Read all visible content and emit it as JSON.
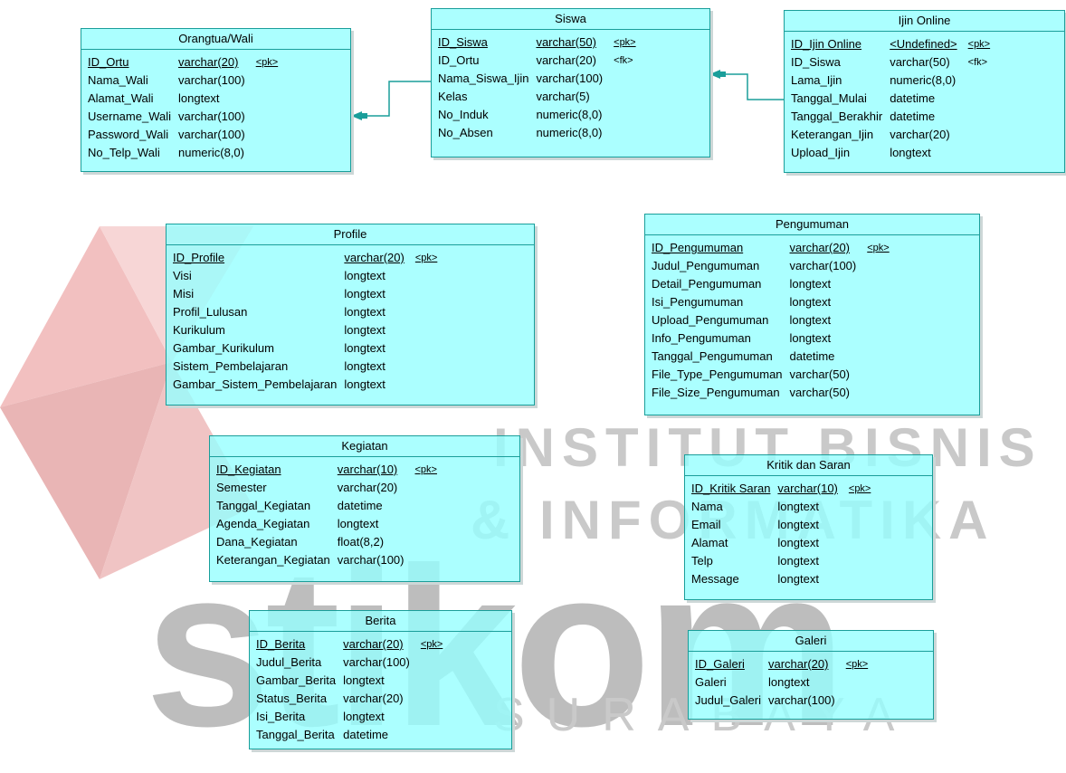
{
  "watermark": {
    "line1": "INSTITUT BISNIS",
    "line2": "& INFORMATIKA",
    "brand": "stikom",
    "line3": "SURABAYA"
  },
  "entities": {
    "orangtua": {
      "title": "Orangtua/Wali",
      "columns": [
        {
          "name": "ID_Ortu",
          "type": "varchar(20)",
          "key": "<pk>"
        },
        {
          "name": "Nama_Wali",
          "type": "varchar(100)",
          "key": ""
        },
        {
          "name": "Alamat_Wali",
          "type": "longtext",
          "key": ""
        },
        {
          "name": "Username_Wali",
          "type": "varchar(100)",
          "key": ""
        },
        {
          "name": "Password_Wali",
          "type": "varchar(100)",
          "key": ""
        },
        {
          "name": "No_Telp_Wali",
          "type": "numeric(8,0)",
          "key": ""
        }
      ]
    },
    "siswa": {
      "title": "Siswa",
      "columns": [
        {
          "name": "ID_Siswa",
          "type": "varchar(50)",
          "key": "<pk>"
        },
        {
          "name": "ID_Ortu",
          "type": "varchar(20)",
          "key": "<fk>"
        },
        {
          "name": "Nama_Siswa_Ijin",
          "type": "varchar(100)",
          "key": ""
        },
        {
          "name": "Kelas",
          "type": "varchar(5)",
          "key": ""
        },
        {
          "name": "No_Induk",
          "type": "numeric(8,0)",
          "key": ""
        },
        {
          "name": "No_Absen",
          "type": "numeric(8,0)",
          "key": ""
        }
      ]
    },
    "ijin": {
      "title": "Ijin Online",
      "columns": [
        {
          "name": "ID_Ijin Online",
          "type": "<Undefined>",
          "key": "<pk>"
        },
        {
          "name": "ID_Siswa",
          "type": "varchar(50)",
          "key": "<fk>"
        },
        {
          "name": "Lama_Ijin",
          "type": "numeric(8,0)",
          "key": ""
        },
        {
          "name": "Tanggal_Mulai",
          "type": "datetime",
          "key": ""
        },
        {
          "name": "Tanggal_Berakhir",
          "type": "datetime",
          "key": ""
        },
        {
          "name": "Keterangan_Ijin",
          "type": "varchar(20)",
          "key": ""
        },
        {
          "name": "Upload_Ijin",
          "type": "longtext",
          "key": ""
        }
      ]
    },
    "profile": {
      "title": "Profile",
      "columns": [
        {
          "name": "ID_Profile",
          "type": "varchar(20)",
          "key": "<pk>"
        },
        {
          "name": "Visi",
          "type": "longtext",
          "key": ""
        },
        {
          "name": "Misi",
          "type": "longtext",
          "key": ""
        },
        {
          "name": "Profil_Lulusan",
          "type": "longtext",
          "key": ""
        },
        {
          "name": "Kurikulum",
          "type": "longtext",
          "key": ""
        },
        {
          "name": "Gambar_Kurikulum",
          "type": "longtext",
          "key": ""
        },
        {
          "name": "Sistem_Pembelajaran",
          "type": "longtext",
          "key": ""
        },
        {
          "name": "Gambar_Sistem_Pembelajaran",
          "type": "longtext",
          "key": ""
        }
      ]
    },
    "pengumuman": {
      "title": "Pengumuman",
      "columns": [
        {
          "name": "ID_Pengumuman",
          "type": "varchar(20)",
          "key": "<pk>"
        },
        {
          "name": "Judul_Pengumuman",
          "type": "varchar(100)",
          "key": ""
        },
        {
          "name": "Detail_Pengumuman",
          "type": "longtext",
          "key": ""
        },
        {
          "name": "Isi_Pengumuman",
          "type": "longtext",
          "key": ""
        },
        {
          "name": "Upload_Pengumuman",
          "type": "longtext",
          "key": ""
        },
        {
          "name": "Info_Pengumuman",
          "type": "longtext",
          "key": ""
        },
        {
          "name": "Tanggal_Pengumuman",
          "type": "datetime",
          "key": ""
        },
        {
          "name": "File_Type_Pengumuman",
          "type": "varchar(50)",
          "key": ""
        },
        {
          "name": "File_Size_Pengumuman",
          "type": "varchar(50)",
          "key": ""
        }
      ]
    },
    "kegiatan": {
      "title": "Kegiatan",
      "columns": [
        {
          "name": "ID_Kegiatan",
          "type": "varchar(10)",
          "key": "<pk>"
        },
        {
          "name": "Semester",
          "type": "varchar(20)",
          "key": ""
        },
        {
          "name": "Tanggal_Kegiatan",
          "type": "datetime",
          "key": ""
        },
        {
          "name": "Agenda_Kegiatan",
          "type": "longtext",
          "key": ""
        },
        {
          "name": "Dana_Kegiatan",
          "type": "float(8,2)",
          "key": ""
        },
        {
          "name": "Keterangan_Kegiatan",
          "type": "varchar(100)",
          "key": ""
        }
      ]
    },
    "kritik": {
      "title": "Kritik dan Saran",
      "columns": [
        {
          "name": "ID_Kritik Saran",
          "type": "varchar(10)",
          "key": "<pk>"
        },
        {
          "name": "Nama",
          "type": "longtext",
          "key": ""
        },
        {
          "name": "Email",
          "type": "longtext",
          "key": ""
        },
        {
          "name": "Alamat",
          "type": "longtext",
          "key": ""
        },
        {
          "name": "Telp",
          "type": "longtext",
          "key": ""
        },
        {
          "name": "Message",
          "type": "longtext",
          "key": ""
        }
      ]
    },
    "berita": {
      "title": "Berita",
      "columns": [
        {
          "name": "ID_Berita",
          "type": "varchar(20)",
          "key": "<pk>"
        },
        {
          "name": "Judul_Berita",
          "type": "varchar(100)",
          "key": ""
        },
        {
          "name": "Gambar_Berita",
          "type": "longtext",
          "key": ""
        },
        {
          "name": "Status_Berita",
          "type": "varchar(20)",
          "key": ""
        },
        {
          "name": "Isi_Berita",
          "type": "longtext",
          "key": ""
        },
        {
          "name": "Tanggal_Berita",
          "type": "datetime",
          "key": ""
        }
      ]
    },
    "galeri": {
      "title": "Galeri",
      "columns": [
        {
          "name": "ID_Galeri",
          "type": "varchar(20)",
          "key": "<pk>"
        },
        {
          "name": "Galeri",
          "type": "longtext",
          "key": ""
        },
        {
          "name": "Judul_Galeri",
          "type": "varchar(100)",
          "key": ""
        }
      ]
    }
  }
}
